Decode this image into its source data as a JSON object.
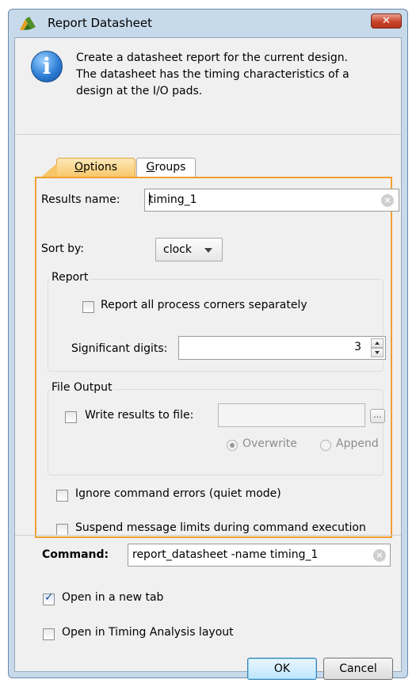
{
  "window": {
    "title": "Report Datasheet",
    "close_glyph": "✕"
  },
  "info": {
    "icon": "info-icon",
    "lines": [
      "Create a datasheet report for the current design.",
      "The datasheet has the timing characteristics of a",
      "design at the I/O pads."
    ]
  },
  "tabs": {
    "options": {
      "label": "Options",
      "underline": "O",
      "rest": "ptions"
    },
    "groups": {
      "label": "Groups",
      "underline": "G",
      "rest": "roups"
    }
  },
  "options": {
    "results_name_label": "Results name:",
    "results_name_value": "timing_1",
    "sort_by_label": "Sort by:",
    "sort_by_value": "clock",
    "report_group_title": "Report",
    "report_all_corners_label": "Report all process corners separately",
    "report_all_corners_checked": false,
    "significant_digits_label": "Significant digits:",
    "significant_digits_value": "3",
    "file_output_group_title": "File Output",
    "write_results_label": "Write results to file:",
    "write_results_checked": false,
    "write_results_path": "",
    "browse_label": "...",
    "overwrite_label": "Overwrite",
    "overwrite_selected": true,
    "append_label": "Append",
    "append_selected": false,
    "ignore_errors_label": "Ignore command errors (quiet mode)",
    "ignore_errors_checked": false,
    "suspend_limits_label": "Suspend message limits during command execution",
    "suspend_limits_checked": false
  },
  "command": {
    "label": "Command:",
    "value": "report_datasheet -name timing_1"
  },
  "footer": {
    "open_new_tab_label": "Open in a new tab",
    "open_new_tab_checked": true,
    "open_timing_layout_label": "Open in Timing Analysis layout",
    "open_timing_layout_checked": false,
    "ok_label": "OK",
    "cancel_label": "Cancel"
  },
  "colors": {
    "accent_tab": "#f7c667",
    "panel_border": "#f0a030",
    "window_frame": "#c7daeb",
    "close_button": "#c7452b"
  }
}
